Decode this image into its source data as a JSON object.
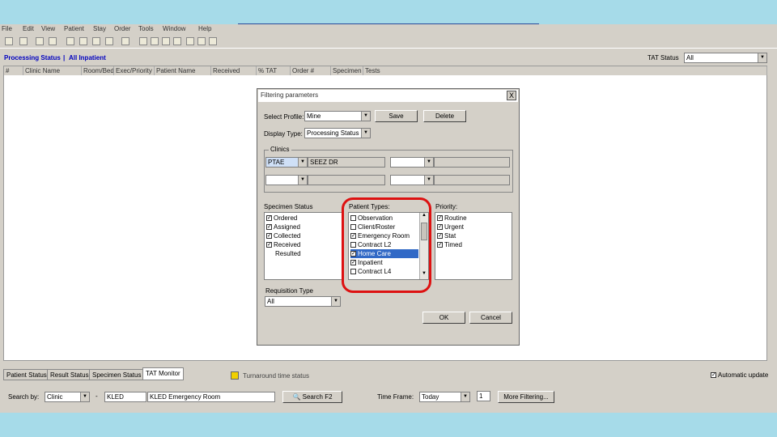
{
  "menu": [
    "File",
    "Edit",
    "View",
    "Patient",
    "Stay",
    "Order",
    "Tools",
    "Window",
    "Help"
  ],
  "header": {
    "processing_status": "Processing Status",
    "separator": " | ",
    "all_inpatient": "All Inpatient",
    "tat_status_label": "TAT Status",
    "tat_status_value": "All"
  },
  "columns": [
    "#",
    "Clinic Name",
    "Room/Bed",
    "Exec/Priority",
    "Patient Name",
    "Received",
    "% TAT",
    "Order #",
    "Specimen",
    "Tests"
  ],
  "tabs": [
    "Patient Status",
    "Result Status",
    "Specimen Status",
    "TAT Monitor"
  ],
  "status_icon_text": "Turnaround time status",
  "auto_update_label": "Automatic update",
  "auto_update_checked": true,
  "bottom": {
    "search_by_label": "Search by:",
    "search_by_value": "Clinic",
    "clinic_code": "KLED",
    "clinic_name": "KLED Emergency Room",
    "search_button": "Search F2",
    "time_frame_label": "Time Frame:",
    "time_frame_value": "Today",
    "time_frame_count": "1",
    "more_filtering": "More Filtering..."
  },
  "dialog": {
    "title": "Filtering parameters",
    "close": "X",
    "select_profile_label": "Select Profile:",
    "select_profile_value": "Mine",
    "save_button": "Save",
    "delete_button": "Delete",
    "display_type_label": "Display Type:",
    "display_type_value": "Processing Status",
    "clinics_label": "Clinics",
    "clinic_code": "PTAE",
    "clinic_name": "SEEZ DR",
    "specimen_status_label": "Specimen Status",
    "specimen_status": [
      {
        "label": "Ordered",
        "checked": true
      },
      {
        "label": "Assigned",
        "checked": true
      },
      {
        "label": "Collected",
        "checked": true
      },
      {
        "label": "Received",
        "checked": true
      },
      {
        "label": "Resulted",
        "checked": false
      }
    ],
    "patient_types_label": "Patient Types:",
    "patient_types": [
      {
        "label": "Observation",
        "checked": false
      },
      {
        "label": "Client/Roster",
        "checked": false
      },
      {
        "label": "Emergency Room",
        "checked": true
      },
      {
        "label": "Contract L2",
        "checked": false
      },
      {
        "label": "Home Care",
        "checked": true,
        "selected": true
      },
      {
        "label": "Inpatient",
        "checked": true
      },
      {
        "label": "Contract L4",
        "checked": false
      }
    ],
    "priority_label": "Priority:",
    "priorities": [
      {
        "label": "Routine",
        "checked": true
      },
      {
        "label": "Urgent",
        "checked": true
      },
      {
        "label": "Stat",
        "checked": true
      },
      {
        "label": "Timed",
        "checked": true
      }
    ],
    "requisition_type_label": "Requisition Type",
    "requisition_type_value": "All",
    "ok_button": "OK",
    "cancel_button": "Cancel"
  },
  "colors": {
    "highlight": "#3169c6",
    "annotation": "#dd1111",
    "link": "#0000c0"
  }
}
